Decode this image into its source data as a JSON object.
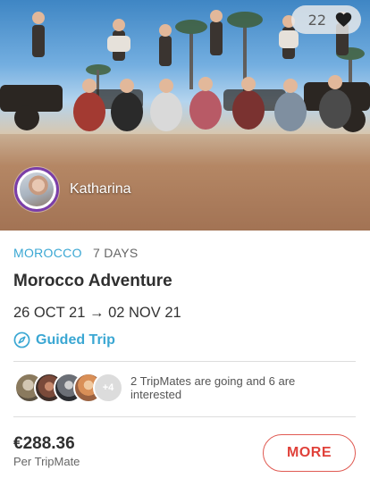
{
  "hero": {
    "like_count": "22",
    "icons": {
      "like": "heart-icon"
    }
  },
  "host": {
    "name": "Katharina"
  },
  "trip": {
    "country": "MOROCCO",
    "duration": "7 DAYS",
    "title": "Morocco Adventure",
    "dates": "26 OCT 21 → 02 NOV 21",
    "type_label": "Guided Trip",
    "type_icon": "compass-icon"
  },
  "tripmates": {
    "extra_count": "+4",
    "summary": "2 TripMates are going and 6 are interested"
  },
  "pricing": {
    "price": "€288.36",
    "unit": "Per TripMate"
  },
  "actions": {
    "more_label": "MORE"
  },
  "colors": {
    "accent_blue": "#3aa7d3",
    "accent_red": "#e0413a",
    "host_ring": "#7b3ea8"
  }
}
